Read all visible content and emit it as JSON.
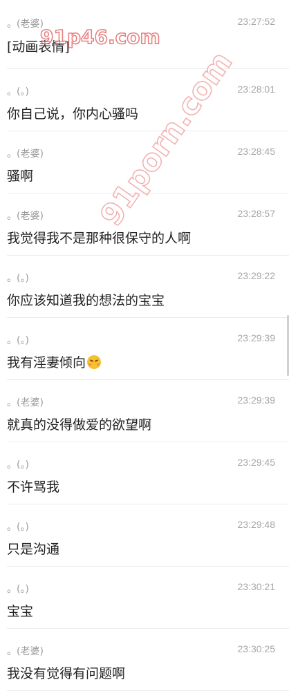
{
  "messages": [
    {
      "sender": "。(老婆)",
      "time": "23:27:52",
      "text": "[动画表情]"
    },
    {
      "sender": "。(。)",
      "time": "23:28:01",
      "text": "你自己说，你内心骚吗"
    },
    {
      "sender": "。(老婆)",
      "time": "23:28:45",
      "text": "骚啊"
    },
    {
      "sender": "。(老婆)",
      "time": "23:28:57",
      "text": "我觉得我不是那种很保守的人啊"
    },
    {
      "sender": "。(。)",
      "time": "23:29:22",
      "text": "你应该知道我的想法的宝宝"
    },
    {
      "sender": "。(。)",
      "time": "23:29:39",
      "text": "我有淫妻倾向",
      "emoji": "blushing-face-emoji"
    },
    {
      "sender": "。(老婆)",
      "time": "23:29:39",
      "text": "就真的没得做爱的欲望啊"
    },
    {
      "sender": "。(。)",
      "time": "23:29:45",
      "text": "不许骂我"
    },
    {
      "sender": "。(。)",
      "time": "23:29:48",
      "text": "只是沟通"
    },
    {
      "sender": "。(。)",
      "time": "23:30:21",
      "text": "宝宝"
    },
    {
      "sender": "。(老婆)",
      "time": "23:30:25",
      "text": "我没有觉得有问题啊"
    }
  ],
  "watermarks": [
    "91p46.com",
    "91porn.com"
  ],
  "colors": {
    "background": "#ffffff",
    "text": "#222222",
    "meta": "#9a9a9a",
    "divider": "#ececec",
    "watermark": "#e25555"
  }
}
